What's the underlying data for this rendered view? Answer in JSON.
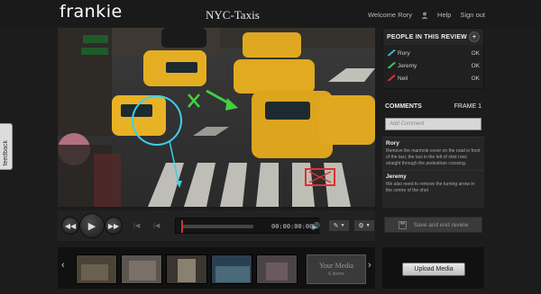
{
  "app": {
    "logo": "frankie",
    "review_title": "NYC-Taxis"
  },
  "user_bar": {
    "welcome": "Welcome Rory",
    "help": "Help",
    "sign_out": "Sign out"
  },
  "people_panel": {
    "heading": "PEOPLE IN THIS REVIEW",
    "add_icon": "plus-icon",
    "people": [
      {
        "name": "Rory",
        "status": "OK",
        "pen_color": "#3aaed0"
      },
      {
        "name": "Jeremy",
        "status": "OK",
        "pen_color": "#40c060"
      },
      {
        "name": "Neil",
        "status": "OK",
        "pen_color": "#d83030"
      }
    ]
  },
  "comments_panel": {
    "heading": "COMMENTS",
    "frame_label": "FRAME 1",
    "add_placeholder": "Add Comment",
    "comments": [
      {
        "author": "Rory",
        "text": "Remove the manhole cover on the road in front of the taxi, the taxi in the left of shot runs straight through the pedestrian crossing."
      },
      {
        "author": "Jeremy",
        "text": "We also need to remove the turning arrow in the centre of the shot"
      }
    ]
  },
  "player": {
    "timecode": "00:00:00:00",
    "progress": 0.0,
    "icons": [
      "rewind-icon",
      "play-icon",
      "fast-forward-icon",
      "step-back-icon",
      "step-forward-icon",
      "volume-icon",
      "pen-tool-icon",
      "gear-icon"
    ]
  },
  "actions": {
    "save_end_review": "Save and end review",
    "upload_media": "Upload Media"
  },
  "media": {
    "label": "Your Media",
    "count": "6 items"
  },
  "feedback": {
    "label": "feedback"
  },
  "colors": {
    "accent_cyan": "#3ed0e8",
    "annotation_green": "#40d040",
    "annotation_red": "#e03030",
    "taxi_yellow": "#e8b020"
  }
}
